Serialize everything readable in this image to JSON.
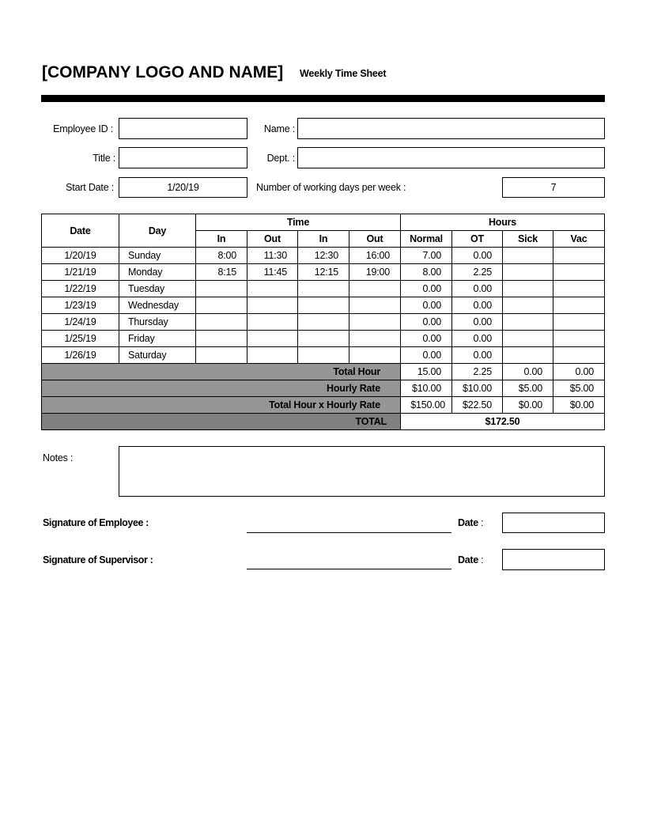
{
  "header": {
    "company": "[COMPANY LOGO AND NAME]",
    "doc_title": "Weekly Time Sheet"
  },
  "fields": {
    "employee_id": {
      "label": "Employee ID :",
      "value": ""
    },
    "name": {
      "label": "Name :",
      "value": ""
    },
    "title": {
      "label": "Title :",
      "value": ""
    },
    "dept": {
      "label": "Dept. :",
      "value": ""
    },
    "start_date": {
      "label": "Start Date :",
      "value": "1/20/19"
    },
    "working_days": {
      "label": "Number of working days per week :",
      "value": "7"
    }
  },
  "table": {
    "headers": {
      "date": "Date",
      "day": "Day",
      "time": "Time",
      "hours": "Hours",
      "time_sub": [
        "In",
        "Out",
        "In",
        "Out"
      ],
      "hours_sub": [
        "Normal",
        "OT",
        "Sick",
        "Vac"
      ]
    },
    "rows": [
      {
        "date": "1/20/19",
        "day": "Sunday",
        "in1": "8:00",
        "out1": "11:30",
        "in2": "12:30",
        "out2": "16:00",
        "normal": "7.00",
        "ot": "0.00",
        "sick": "",
        "vac": ""
      },
      {
        "date": "1/21/19",
        "day": "Monday",
        "in1": "8:15",
        "out1": "11:45",
        "in2": "12:15",
        "out2": "19:00",
        "normal": "8.00",
        "ot": "2.25",
        "sick": "",
        "vac": ""
      },
      {
        "date": "1/22/19",
        "day": "Tuesday",
        "in1": "",
        "out1": "",
        "in2": "",
        "out2": "",
        "normal": "0.00",
        "ot": "0.00",
        "sick": "",
        "vac": ""
      },
      {
        "date": "1/23/19",
        "day": "Wednesday",
        "in1": "",
        "out1": "",
        "in2": "",
        "out2": "",
        "normal": "0.00",
        "ot": "0.00",
        "sick": "",
        "vac": ""
      },
      {
        "date": "1/24/19",
        "day": "Thursday",
        "in1": "",
        "out1": "",
        "in2": "",
        "out2": "",
        "normal": "0.00",
        "ot": "0.00",
        "sick": "",
        "vac": ""
      },
      {
        "date": "1/25/19",
        "day": "Friday",
        "in1": "",
        "out1": "",
        "in2": "",
        "out2": "",
        "normal": "0.00",
        "ot": "0.00",
        "sick": "",
        "vac": ""
      },
      {
        "date": "1/26/19",
        "day": "Saturday",
        "in1": "",
        "out1": "",
        "in2": "",
        "out2": "",
        "normal": "0.00",
        "ot": "0.00",
        "sick": "",
        "vac": ""
      }
    ],
    "summary": [
      {
        "label": "Total Hour",
        "normal": "15.00",
        "ot": "2.25",
        "sick": "0.00",
        "vac": "0.00"
      },
      {
        "label": "Hourly Rate",
        "normal": "$10.00",
        "ot": "$10.00",
        "sick": "$5.00",
        "vac": "$5.00"
      },
      {
        "label": "Total Hour x Hourly Rate",
        "normal": "$150.00",
        "ot": "$22.50",
        "sick": "$0.00",
        "vac": "$0.00"
      }
    ],
    "total": {
      "label": "TOTAL",
      "value": "$172.50"
    }
  },
  "notes": {
    "label": "Notes :",
    "value": ""
  },
  "signatures": {
    "employee": {
      "label": "Signature of Employee :",
      "date_label": "Date",
      "date_colon": " :",
      "date_value": ""
    },
    "supervisor": {
      "label": "Signature of Supervisor :",
      "date_label": "Date",
      "date_colon": " :",
      "date_value": ""
    }
  },
  "colors": {
    "summary_fill": "#969696",
    "total_fill": "#808080"
  }
}
